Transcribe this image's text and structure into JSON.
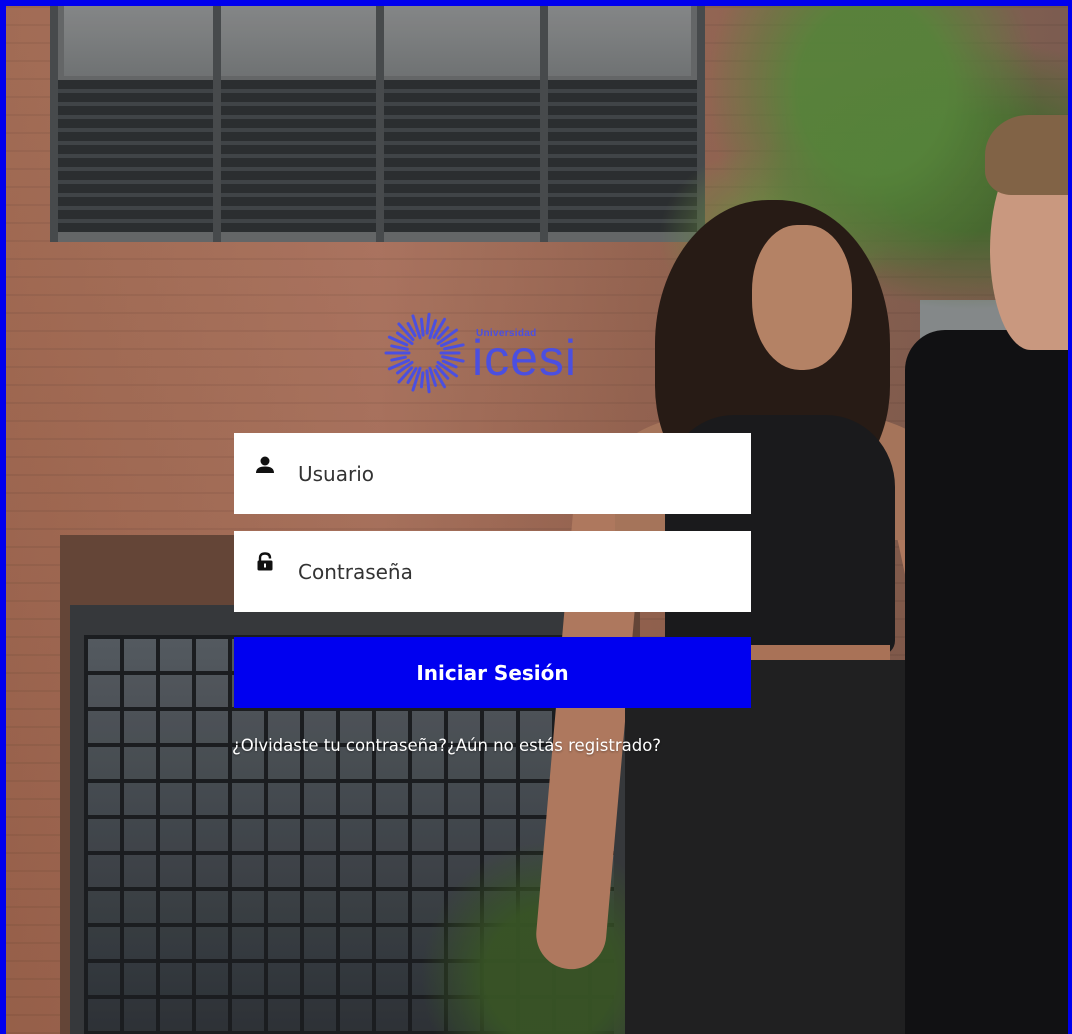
{
  "brand": {
    "small_text": "Universidad",
    "big_text": "icesi",
    "color": "#4b4fe0",
    "icon": "sun-burst-logo-icon"
  },
  "login": {
    "username_placeholder": "Usuario",
    "username_icon": "user-icon",
    "password_placeholder": "Contraseña",
    "password_icon": "lock-icon",
    "submit_label": "Iniciar Sesión",
    "submit_color": "#0000f0",
    "forgot_link": "¿Olvidaste tu contraseña?",
    "register_link": "¿Aún no estás registrado?"
  },
  "theme": {
    "border_color": "#0000ee"
  }
}
